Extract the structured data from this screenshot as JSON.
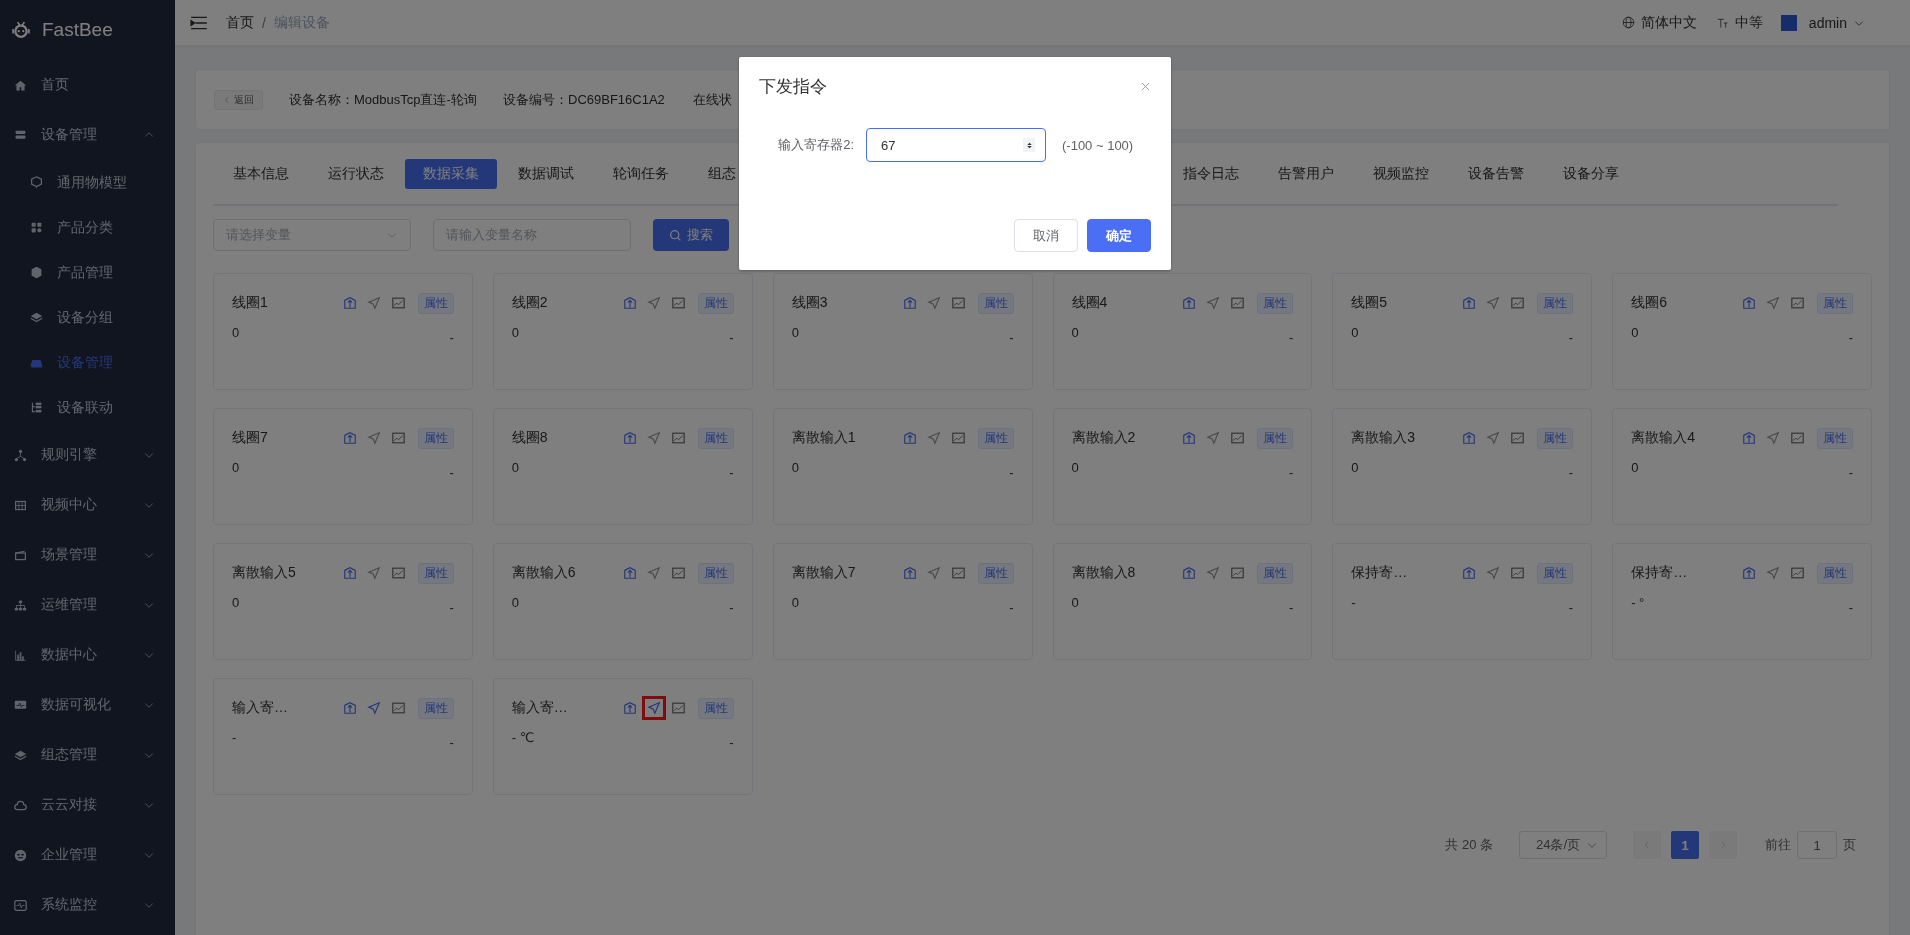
{
  "sidebar": {
    "logo": "FastBee",
    "items": [
      {
        "label": "首页",
        "selected": false
      },
      {
        "label": "设备管理",
        "selected": false,
        "expanded": true,
        "children": [
          {
            "label": "通用物模型",
            "selected": false
          },
          {
            "label": "产品分类",
            "selected": false
          },
          {
            "label": "产品管理",
            "selected": false
          },
          {
            "label": "设备分组",
            "selected": false
          },
          {
            "label": "设备管理",
            "selected": true
          },
          {
            "label": "设备联动",
            "selected": false
          }
        ]
      },
      {
        "label": "规则引擎",
        "selected": false,
        "expanded": false
      },
      {
        "label": "视频中心",
        "selected": false,
        "expanded": false
      },
      {
        "label": "场景管理",
        "selected": false,
        "expanded": false
      },
      {
        "label": "运维管理",
        "selected": false,
        "expanded": false
      },
      {
        "label": "数据中心",
        "selected": false,
        "expanded": false
      },
      {
        "label": "数据可视化",
        "selected": false,
        "expanded": false
      },
      {
        "label": "组态管理",
        "selected": false,
        "expanded": false
      },
      {
        "label": "云云对接",
        "selected": false,
        "expanded": false
      },
      {
        "label": "企业管理",
        "selected": false,
        "expanded": false
      },
      {
        "label": "系统监控",
        "selected": false,
        "expanded": false
      }
    ]
  },
  "header": {
    "breadcrumb": [
      "首页",
      "编辑设备"
    ],
    "breadcrumb_separator": "/",
    "language": "简体中文",
    "size": "中等",
    "user": "admin"
  },
  "device_info": {
    "back": "返回",
    "fields": [
      "设备名称：ModbusTcp直连-轮询",
      "设备编号：DC69BF16C1A2",
      "在线状"
    ]
  },
  "tabs": [
    {
      "label": "基本信息",
      "selected": false
    },
    {
      "label": "运行状态",
      "selected": false
    },
    {
      "label": "数据采集",
      "selected": true
    },
    {
      "label": "数据调试",
      "selected": false
    },
    {
      "label": "轮询任务",
      "selected": false
    },
    {
      "label": "组态",
      "selected": false
    },
    {
      "label": "指令日志",
      "selected": false
    },
    {
      "label": "告警用户",
      "selected": false
    },
    {
      "label": "视频监控",
      "selected": false
    },
    {
      "label": "设备告警",
      "selected": false
    },
    {
      "label": "设备分享",
      "selected": false
    }
  ],
  "filters": {
    "variable_select": {
      "placeholder": "请选择变量"
    },
    "name_input": {
      "placeholder": "请输入变量名称"
    },
    "search_button": "搜索"
  },
  "cards": [
    {
      "title": "线圈1",
      "value": "0",
      "updated": "-",
      "tag": "属性",
      "send_enabled": false,
      "highlighted": false
    },
    {
      "title": "线圈2",
      "value": "0",
      "updated": "-",
      "tag": "属性",
      "send_enabled": false,
      "highlighted": false
    },
    {
      "title": "线圈3",
      "value": "0",
      "updated": "-",
      "tag": "属性",
      "send_enabled": false,
      "highlighted": false
    },
    {
      "title": "线圈4",
      "value": "0",
      "updated": "-",
      "tag": "属性",
      "send_enabled": false,
      "highlighted": false
    },
    {
      "title": "线圈5",
      "value": "0",
      "updated": "-",
      "tag": "属性",
      "send_enabled": false,
      "highlighted": false
    },
    {
      "title": "线圈6",
      "value": "0",
      "updated": "-",
      "tag": "属性",
      "send_enabled": false,
      "highlighted": false
    },
    {
      "title": "线圈7",
      "value": "0",
      "updated": "-",
      "tag": "属性",
      "send_enabled": false,
      "highlighted": false
    },
    {
      "title": "线圈8",
      "value": "0",
      "updated": "-",
      "tag": "属性",
      "send_enabled": false,
      "highlighted": false
    },
    {
      "title": "离散输入1",
      "value": "0",
      "updated": "-",
      "tag": "属性",
      "send_enabled": false,
      "highlighted": false
    },
    {
      "title": "离散输入2",
      "value": "0",
      "updated": "-",
      "tag": "属性",
      "send_enabled": false,
      "highlighted": false
    },
    {
      "title": "离散输入3",
      "value": "0",
      "updated": "-",
      "tag": "属性",
      "send_enabled": false,
      "highlighted": false
    },
    {
      "title": "离散输入4",
      "value": "0",
      "updated": "-",
      "tag": "属性",
      "send_enabled": false,
      "highlighted": false
    },
    {
      "title": "离散输入5",
      "value": "0",
      "updated": "-",
      "tag": "属性",
      "send_enabled": false,
      "highlighted": false
    },
    {
      "title": "离散输入6",
      "value": "0",
      "updated": "-",
      "tag": "属性",
      "send_enabled": false,
      "highlighted": false
    },
    {
      "title": "离散输入7",
      "value": "0",
      "updated": "-",
      "tag": "属性",
      "send_enabled": false,
      "highlighted": false
    },
    {
      "title": "离散输入8",
      "value": "0",
      "updated": "-",
      "tag": "属性",
      "send_enabled": false,
      "highlighted": false
    },
    {
      "title": "保持寄…",
      "value": "-",
      "updated": "-",
      "tag": "属性",
      "send_enabled": false,
      "highlighted": false
    },
    {
      "title": "保持寄…",
      "value": "- °",
      "updated": "-",
      "tag": "属性",
      "send_enabled": false,
      "highlighted": false
    },
    {
      "title": "输入寄…",
      "value": "-",
      "updated": "-",
      "tag": "属性",
      "send_enabled": true,
      "highlighted": false
    },
    {
      "title": "输入寄…",
      "value": "- ℃",
      "updated": "-",
      "tag": "属性",
      "send_enabled": true,
      "highlighted": true
    }
  ],
  "pagination": {
    "total": "共 20 条",
    "page_size": "24条/页",
    "pages": [
      {
        "label": "1",
        "selected": true
      }
    ],
    "goto_label": "前往",
    "goto_value": "1",
    "goto_suffix": "页"
  },
  "dialog": {
    "title": "下发指令",
    "label": "输入寄存器2:",
    "value": "67",
    "range": "(-100 ~ 100)",
    "buttons": [
      {
        "label": "取消",
        "kind": "default"
      },
      {
        "label": "确定",
        "kind": "primary"
      }
    ]
  }
}
